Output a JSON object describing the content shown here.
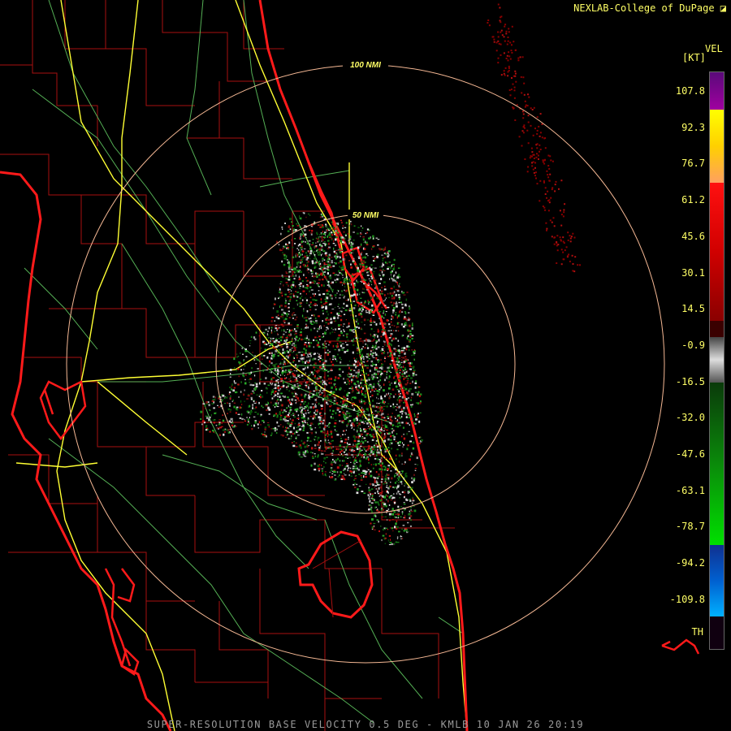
{
  "credit": "NEXLAB-College of DuPage",
  "footer": "SUPER-RESOLUTION BASE VELOCITY 0.5 DEG - KMLB 10 JAN 26 20:19",
  "scale": {
    "product": "VEL",
    "unit": "[KT]",
    "ticks": [
      "107.8",
      "92.3",
      "76.7",
      "61.2",
      "45.6",
      "30.1",
      "14.5",
      "-0.9",
      "-16.5",
      "-32.0",
      "-47.6",
      "-63.1",
      "-78.7",
      "-94.2",
      "-109.8",
      "TH"
    ]
  },
  "range_rings": {
    "inner_label": "50 NMI",
    "outer_label": "100 NMI"
  },
  "colors": {
    "coast": "#ff1a1a",
    "county": "#b01010",
    "highway": "#ffff33",
    "road": "#66cc66",
    "ring": "#f5b894",
    "label": "#ffff66"
  }
}
